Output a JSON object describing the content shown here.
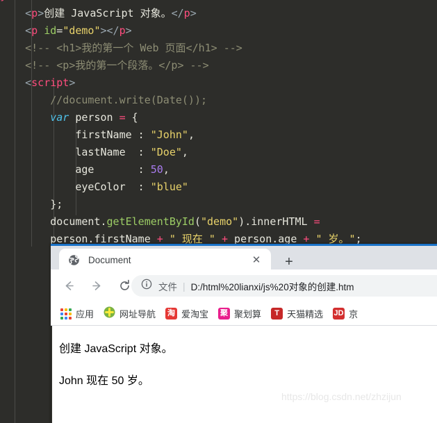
{
  "editor": {
    "theme_bg": "#2d2d2a",
    "lines": [
      {
        "id": "l0",
        "tokens": [
          {
            "t": "}",
            "c": "pk"
          }
        ]
      },
      {
        "id": "l1",
        "tokens": [
          {
            "t": "    ",
            "c": "tx"
          },
          {
            "t": "<",
            "c": "br"
          },
          {
            "t": "p",
            "c": "pk"
          },
          {
            "t": ">",
            "c": "br"
          },
          {
            "t": "创建 JavaScript 对象。",
            "c": "tx"
          },
          {
            "t": "</",
            "c": "br"
          },
          {
            "t": "p",
            "c": "pk"
          },
          {
            "t": ">",
            "c": "br"
          }
        ]
      },
      {
        "id": "l2",
        "tokens": [
          {
            "t": "    ",
            "c": "tx"
          },
          {
            "t": "<",
            "c": "br"
          },
          {
            "t": "p",
            "c": "pk"
          },
          {
            "t": " ",
            "c": "tx"
          },
          {
            "t": "id",
            "c": "at"
          },
          {
            "t": "=",
            "c": "op"
          },
          {
            "t": "\"demo\"",
            "c": "st"
          },
          {
            "t": ">",
            "c": "br"
          },
          {
            "t": "</",
            "c": "br"
          },
          {
            "t": "p",
            "c": "pk"
          },
          {
            "t": ">",
            "c": "br"
          }
        ]
      },
      {
        "id": "l3",
        "tokens": [
          {
            "t": "    <!-- <h1>我的第一个 Web 页面</h1> -->",
            "c": "cm"
          }
        ]
      },
      {
        "id": "l4",
        "tokens": [
          {
            "t": "    <!-- <p>我的第一个段落。</p> -->",
            "c": "cm"
          }
        ]
      },
      {
        "id": "l5",
        "tokens": [
          {
            "t": "    ",
            "c": "tx"
          },
          {
            "t": "<",
            "c": "br"
          },
          {
            "t": "script",
            "c": "pk"
          },
          {
            "t": ">",
            "c": "br"
          }
        ]
      },
      {
        "id": "l6",
        "tokens": [
          {
            "t": "        //document.write(Date());",
            "c": "cm"
          }
        ]
      },
      {
        "id": "l7",
        "tokens": [
          {
            "t": "        ",
            "c": "tx"
          },
          {
            "t": "var",
            "c": "kwi"
          },
          {
            "t": " person ",
            "c": "tx"
          },
          {
            "t": "=",
            "c": "eq"
          },
          {
            "t": " {",
            "c": "tx"
          }
        ]
      },
      {
        "id": "l8",
        "tokens": [
          {
            "t": "            firstName : ",
            "c": "tx"
          },
          {
            "t": "\"John\"",
            "c": "st"
          },
          {
            "t": ",",
            "c": "tx"
          }
        ]
      },
      {
        "id": "l9",
        "tokens": [
          {
            "t": "            lastName  : ",
            "c": "tx"
          },
          {
            "t": "\"Doe\"",
            "c": "st"
          },
          {
            "t": ",",
            "c": "tx"
          }
        ]
      },
      {
        "id": "l10",
        "tokens": [
          {
            "t": "            age       : ",
            "c": "tx"
          },
          {
            "t": "50",
            "c": "num"
          },
          {
            "t": ",",
            "c": "tx"
          }
        ]
      },
      {
        "id": "l11",
        "tokens": [
          {
            "t": "            eyeColor  : ",
            "c": "tx"
          },
          {
            "t": "\"blue\"",
            "c": "st"
          }
        ]
      },
      {
        "id": "l12",
        "tokens": [
          {
            "t": "        };",
            "c": "tx"
          }
        ]
      },
      {
        "id": "l13",
        "tokens": [
          {
            "t": "        document.",
            "c": "tx"
          },
          {
            "t": "getElementById",
            "c": "fn"
          },
          {
            "t": "(",
            "c": "tx"
          },
          {
            "t": "\"demo\"",
            "c": "st"
          },
          {
            "t": ").innerHTML ",
            "c": "tx"
          },
          {
            "t": "=",
            "c": "eq"
          }
        ]
      },
      {
        "id": "l14",
        "tokens": [
          {
            "t": "        person.firstName ",
            "c": "tx"
          },
          {
            "t": "+",
            "c": "eq"
          },
          {
            "t": " ",
            "c": "tx"
          },
          {
            "t": "\" 现在 \"",
            "c": "st"
          },
          {
            "t": " ",
            "c": "tx"
          },
          {
            "t": "+",
            "c": "eq"
          },
          {
            "t": " person.age ",
            "c": "tx"
          },
          {
            "t": "+",
            "c": "eq"
          },
          {
            "t": " ",
            "c": "tx"
          },
          {
            "t": "\" 岁。\"",
            "c": "st"
          },
          {
            "t": ";",
            "c": "tx"
          }
        ]
      }
    ]
  },
  "browser": {
    "tab": {
      "title": "Document",
      "favicon_name": "globe-icon",
      "close_label": "✕",
      "newtab_label": "+"
    },
    "toolbar": {
      "back_label": "←",
      "forward_label": "→",
      "reload_label": "⟳",
      "info_label": "ⓘ",
      "url_scheme": "文件",
      "url_divider": "|",
      "url_text": "D:/html%20lianxi/js%20对象的创建.htm"
    },
    "bookmarks": [
      {
        "label": "应用",
        "icon": "apps-grid-icon",
        "icon_text": "",
        "bg": ""
      },
      {
        "label": "网址导航",
        "icon": "nav-plus-icon",
        "icon_text": "+",
        "bg": "#8bc34a"
      },
      {
        "label": "爱淘宝",
        "icon": "taobao-icon",
        "icon_text": "淘",
        "bg": "#e53935"
      },
      {
        "label": "聚划算",
        "icon": "juhuasuan-icon",
        "icon_text": "聚",
        "bg": "#e91e8c"
      },
      {
        "label": "天猫精选",
        "icon": "tmall-icon",
        "icon_text": "T",
        "bg": "#c62828"
      },
      {
        "label": "京",
        "icon": "jd-icon",
        "icon_text": "JD",
        "bg": "#d32f2f"
      }
    ],
    "page": {
      "paragraph1": "创建 JavaScript 对象。",
      "paragraph2": "John 现在 50 岁。",
      "watermark": "https://blog.csdn.net/zhzijun"
    }
  }
}
